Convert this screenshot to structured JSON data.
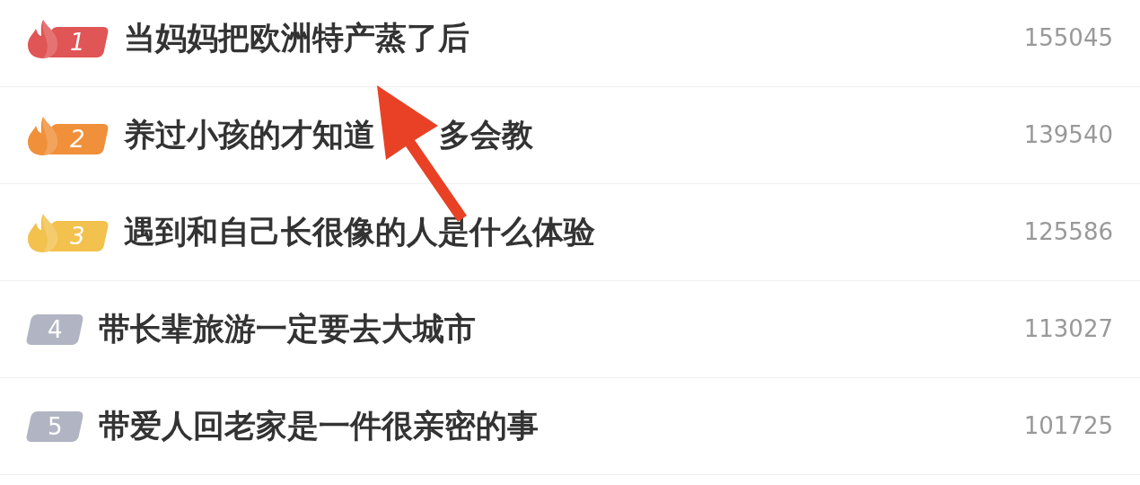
{
  "rows": [
    {
      "rank": "1",
      "kind": "hot",
      "color": "#e05555",
      "title": [
        "当妈妈把欧洲特产蒸了后"
      ],
      "count": "155045"
    },
    {
      "rank": "2",
      "kind": "hot",
      "color": "#f0903a",
      "title": [
        "养过小孩的才知道",
        "多会教"
      ],
      "count": "139540"
    },
    {
      "rank": "3",
      "kind": "hot",
      "color": "#f2c14e",
      "title": [
        "遇到和自己长很像的人是什么体验"
      ],
      "count": "125586"
    },
    {
      "rank": "4",
      "kind": "plain",
      "color": "#b1b5c3",
      "title": [
        "带长辈旅游一定要去大城市"
      ],
      "count": "113027"
    },
    {
      "rank": "5",
      "kind": "plain",
      "color": "#b1b5c3",
      "title": [
        "带爱人回老家是一件很亲密的事"
      ],
      "count": "101725"
    }
  ]
}
